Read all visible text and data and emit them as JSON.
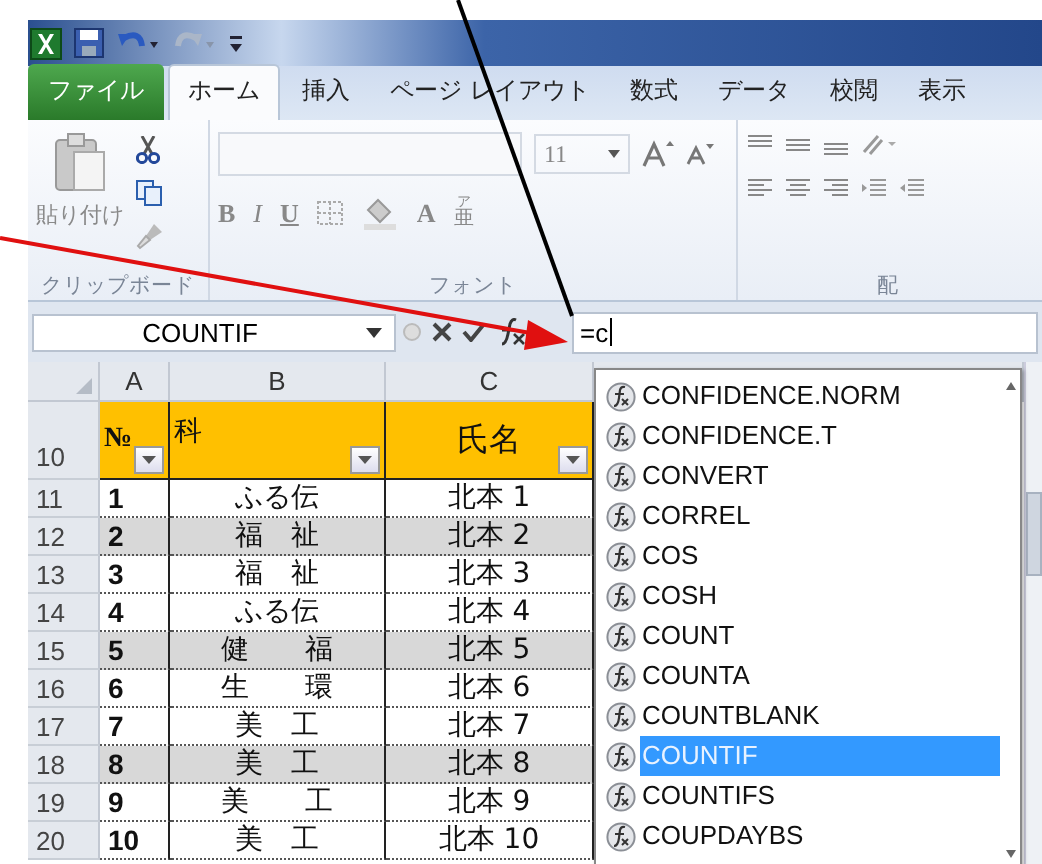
{
  "tabs": [
    {
      "label": "ファイル",
      "kind": "file",
      "selected": false
    },
    {
      "label": "ホーム",
      "kind": "tab",
      "selected": true
    },
    {
      "label": "挿入",
      "kind": "tab",
      "selected": false
    },
    {
      "label": "ページ レイアウト",
      "kind": "tab",
      "selected": false
    },
    {
      "label": "数式",
      "kind": "tab",
      "selected": false
    },
    {
      "label": "データ",
      "kind": "tab",
      "selected": false
    },
    {
      "label": "校閲",
      "kind": "tab",
      "selected": false
    },
    {
      "label": "表示",
      "kind": "tab",
      "selected": false
    }
  ],
  "ribbon": {
    "groups": [
      {
        "kind": "clipboard",
        "label": "クリップボード",
        "paste_label": "貼り付け"
      },
      {
        "kind": "font",
        "label": "フォント",
        "font_size": "11",
        "style_buttons": [
          "B",
          "I",
          "U"
        ],
        "font_color_button": "A",
        "phonetic_ruby": "ア",
        "phonetic_base": "亜"
      },
      {
        "kind": "alignment",
        "label": "配"
      }
    ]
  },
  "formula_bar": {
    "name_box": "COUNTIF",
    "value": "=c"
  },
  "sheet": {
    "corner_columns": [
      "A",
      "B",
      "C"
    ],
    "header_row": {
      "number": "10",
      "cells": [
        "№",
        "科",
        "氏名"
      ]
    },
    "rows": [
      {
        "number": "11",
        "cells": [
          "1",
          "ふる伝",
          "北本 1"
        ],
        "shaded": false
      },
      {
        "number": "12",
        "cells": [
          "2",
          "福　祉",
          "北本 2"
        ],
        "shaded": true
      },
      {
        "number": "13",
        "cells": [
          "3",
          "福　祉",
          "北本 3"
        ],
        "shaded": false
      },
      {
        "number": "14",
        "cells": [
          "4",
          "ふる伝",
          "北本 4"
        ],
        "shaded": false
      },
      {
        "number": "15",
        "cells": [
          "5",
          "健　　福",
          "北本 5"
        ],
        "shaded": true
      },
      {
        "number": "16",
        "cells": [
          "6",
          "生　　環",
          "北本 6"
        ],
        "shaded": false
      },
      {
        "number": "17",
        "cells": [
          "7",
          "美　工",
          "北本 7"
        ],
        "shaded": false
      },
      {
        "number": "18",
        "cells": [
          "8",
          "美　工",
          "北本 8"
        ],
        "shaded": true
      },
      {
        "number": "19",
        "cells": [
          "9",
          "美　　工",
          "北本 9"
        ],
        "shaded": false
      },
      {
        "number": "20",
        "cells": [
          "10",
          "美　工",
          "北本 10"
        ],
        "shaded": false
      }
    ]
  },
  "autocomplete": {
    "items": [
      {
        "label": "CONFIDENCE.NORM",
        "selected": false
      },
      {
        "label": "CONFIDENCE.T",
        "selected": false
      },
      {
        "label": "CONVERT",
        "selected": false
      },
      {
        "label": "CORREL",
        "selected": false
      },
      {
        "label": "COS",
        "selected": false
      },
      {
        "label": "COSH",
        "selected": false
      },
      {
        "label": "COUNT",
        "selected": false
      },
      {
        "label": "COUNTA",
        "selected": false
      },
      {
        "label": "COUNTBLANK",
        "selected": false
      },
      {
        "label": "COUNTIF",
        "selected": true
      },
      {
        "label": "COUNTIFS",
        "selected": false
      },
      {
        "label": "COUPDAYBS",
        "selected": false
      }
    ]
  }
}
